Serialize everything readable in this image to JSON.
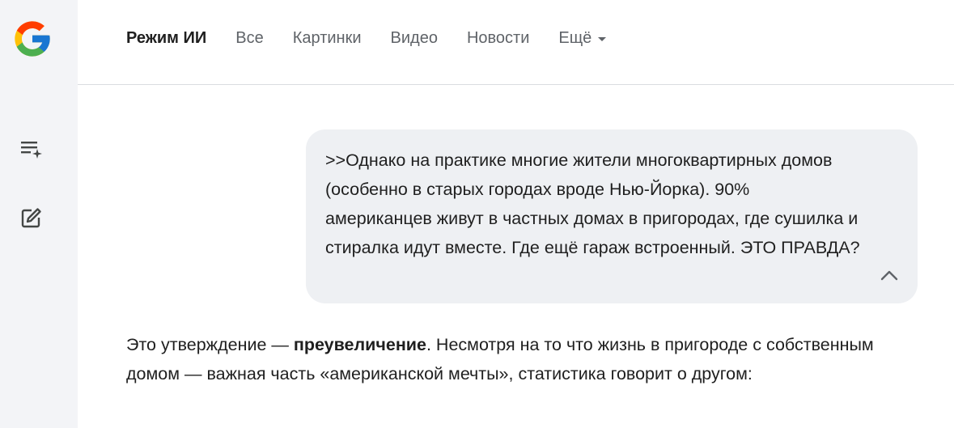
{
  "sidebar": {
    "logo_icon": "google-g-logo",
    "new_thread_icon": "list-sparkle-icon",
    "edit_icon": "edit-square-icon"
  },
  "nav": {
    "tabs": [
      {
        "label": "Режим ИИ",
        "active": true
      },
      {
        "label": "Все"
      },
      {
        "label": "Картинки"
      },
      {
        "label": "Видео"
      },
      {
        "label": "Новости"
      }
    ],
    "more_label": "Ещё"
  },
  "query": {
    "text": ">>Однако на практике многие жители многоквартирных домов (особенно в старых городах вроде Нью-Йорка). 90% американцев живут в частных домах в пригородах, где сушилка и стиралка идут вместе. Где ещё гараж встроенный. ЭТО ПРАВДА?",
    "collapse_icon": "chevron-up-icon"
  },
  "answer": {
    "lead": "Это утверждение — ",
    "bold": "преувеличение",
    "rest": ". Несмотря на то что жизнь в пригороде с собственным домом — важная часть «американской мечты», статистика говорит о другом:"
  },
  "colors": {
    "sidebar_bg": "#f3f4f7",
    "bubble_bg": "#eef0f3",
    "text": "#1f1f1f",
    "muted": "#5f6368",
    "google_blue": "#4285F4",
    "google_red": "#EA4335",
    "google_yellow": "#FBBC05",
    "google_green": "#34A853"
  }
}
